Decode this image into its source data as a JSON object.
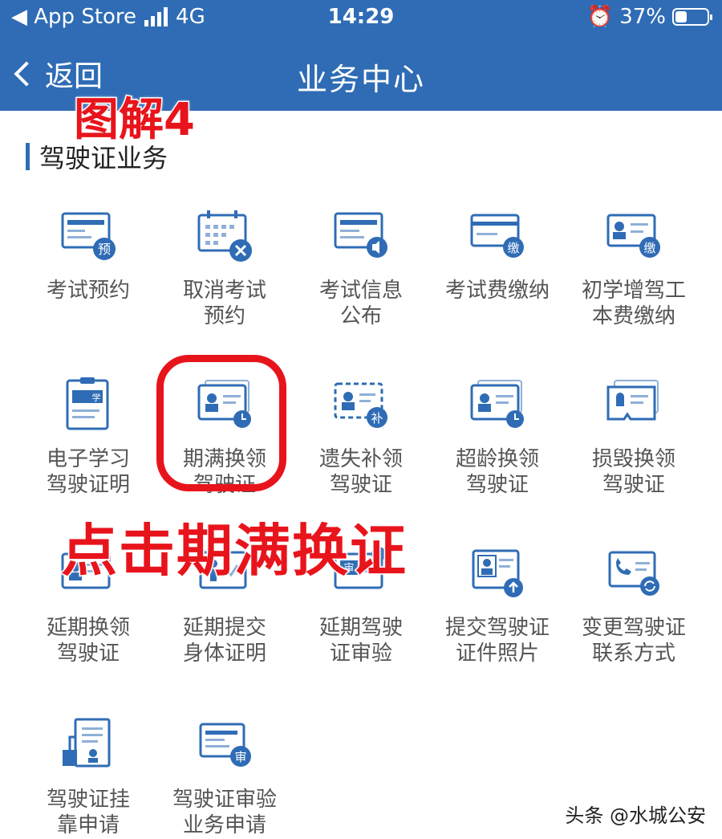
{
  "status": {
    "back_app": "◀ App Store",
    "network": "4G",
    "time": "14:29",
    "alarm_icon": "alarm-clock-icon",
    "battery": "37%"
  },
  "nav": {
    "back_label": "返回",
    "title": "业务中心"
  },
  "overlays": {
    "top_note": "图解4",
    "instruction": "点击期满换证"
  },
  "section": {
    "title": "驾驶证业务"
  },
  "colors": {
    "header": "#2f6cb5",
    "icon_blue": "#2f6cb5",
    "highlight": "#e8141c"
  },
  "tiles": [
    {
      "line1": "考试预约",
      "line2": "",
      "icon": "card-badge-icon",
      "badge": "预"
    },
    {
      "line1": "取消考试",
      "line2": "预约",
      "icon": "calendar-cancel-icon",
      "badge": ""
    },
    {
      "line1": "考试信息",
      "line2": "公布",
      "icon": "card-speaker-icon",
      "badge": ""
    },
    {
      "line1": "考试费缴纳",
      "line2": "",
      "icon": "card-badge-icon",
      "badge": "缴"
    },
    {
      "line1": "初学增驾工",
      "line2": "本费缴纳",
      "icon": "id-card-badge-icon",
      "badge": "缴"
    },
    {
      "line1": "电子学习",
      "line2": "驾驶证明",
      "icon": "clipboard-study-icon",
      "badge": "学"
    },
    {
      "line1": "期满换领",
      "line2": "驾驶证",
      "icon": "id-card-clock-icon",
      "badge": ""
    },
    {
      "line1": "遗失补领",
      "line2": "驾驶证",
      "icon": "dashed-card-badge-icon",
      "badge": "补"
    },
    {
      "line1": "超龄换领",
      "line2": "驾驶证",
      "icon": "id-card-clock-icon",
      "badge": ""
    },
    {
      "line1": "损毁换领",
      "line2": "驾驶证",
      "icon": "torn-card-icon",
      "badge": ""
    },
    {
      "line1": "延期换领",
      "line2": "驾驶证",
      "icon": "id-card-icon",
      "badge": ""
    },
    {
      "line1": "延期提交",
      "line2": "身体证明",
      "icon": "health-chart-icon",
      "badge": ""
    },
    {
      "line1": "延期驾驶",
      "line2": "证审验",
      "icon": "card-review-icon",
      "badge": "审"
    },
    {
      "line1": "提交驾驶证",
      "line2": "证件照片",
      "icon": "photo-upload-icon",
      "badge": ""
    },
    {
      "line1": "变更驾驶证",
      "line2": "联系方式",
      "icon": "phone-card-icon",
      "badge": ""
    },
    {
      "line1": "驾驶证挂",
      "line2": "靠申请",
      "icon": "document-person-icon",
      "badge": ""
    },
    {
      "line1": "驾驶证审验",
      "line2": "业务申请",
      "icon": "card-review-icon",
      "badge": "审"
    }
  ],
  "watermark": "头条 @水城公安"
}
